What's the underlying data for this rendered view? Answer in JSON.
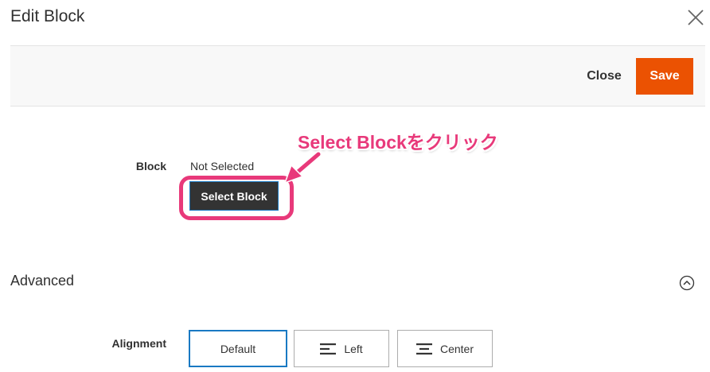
{
  "modal": {
    "title": "Edit Block"
  },
  "toolbar": {
    "close_label": "Close",
    "save_label": "Save",
    "save_color": "#eb5202"
  },
  "block_field": {
    "label": "Block",
    "value": "Not Selected",
    "select_button_label": "Select Block"
  },
  "annotation": {
    "text": "Select Blockをクリック",
    "color": "#e8397a"
  },
  "advanced": {
    "title": "Advanced",
    "alignment_label": "Alignment",
    "options": [
      {
        "label": "Default",
        "icon": "none",
        "selected": true
      },
      {
        "label": "Left",
        "icon": "align-left-icon",
        "selected": false
      },
      {
        "label": "Center",
        "icon": "align-center-icon",
        "selected": false
      }
    ]
  },
  "icons": {
    "close": "close-icon",
    "collapse": "chevron-up-circle-icon"
  },
  "colors": {
    "accent_blue": "#1979c3",
    "dark_button": "#333333"
  }
}
